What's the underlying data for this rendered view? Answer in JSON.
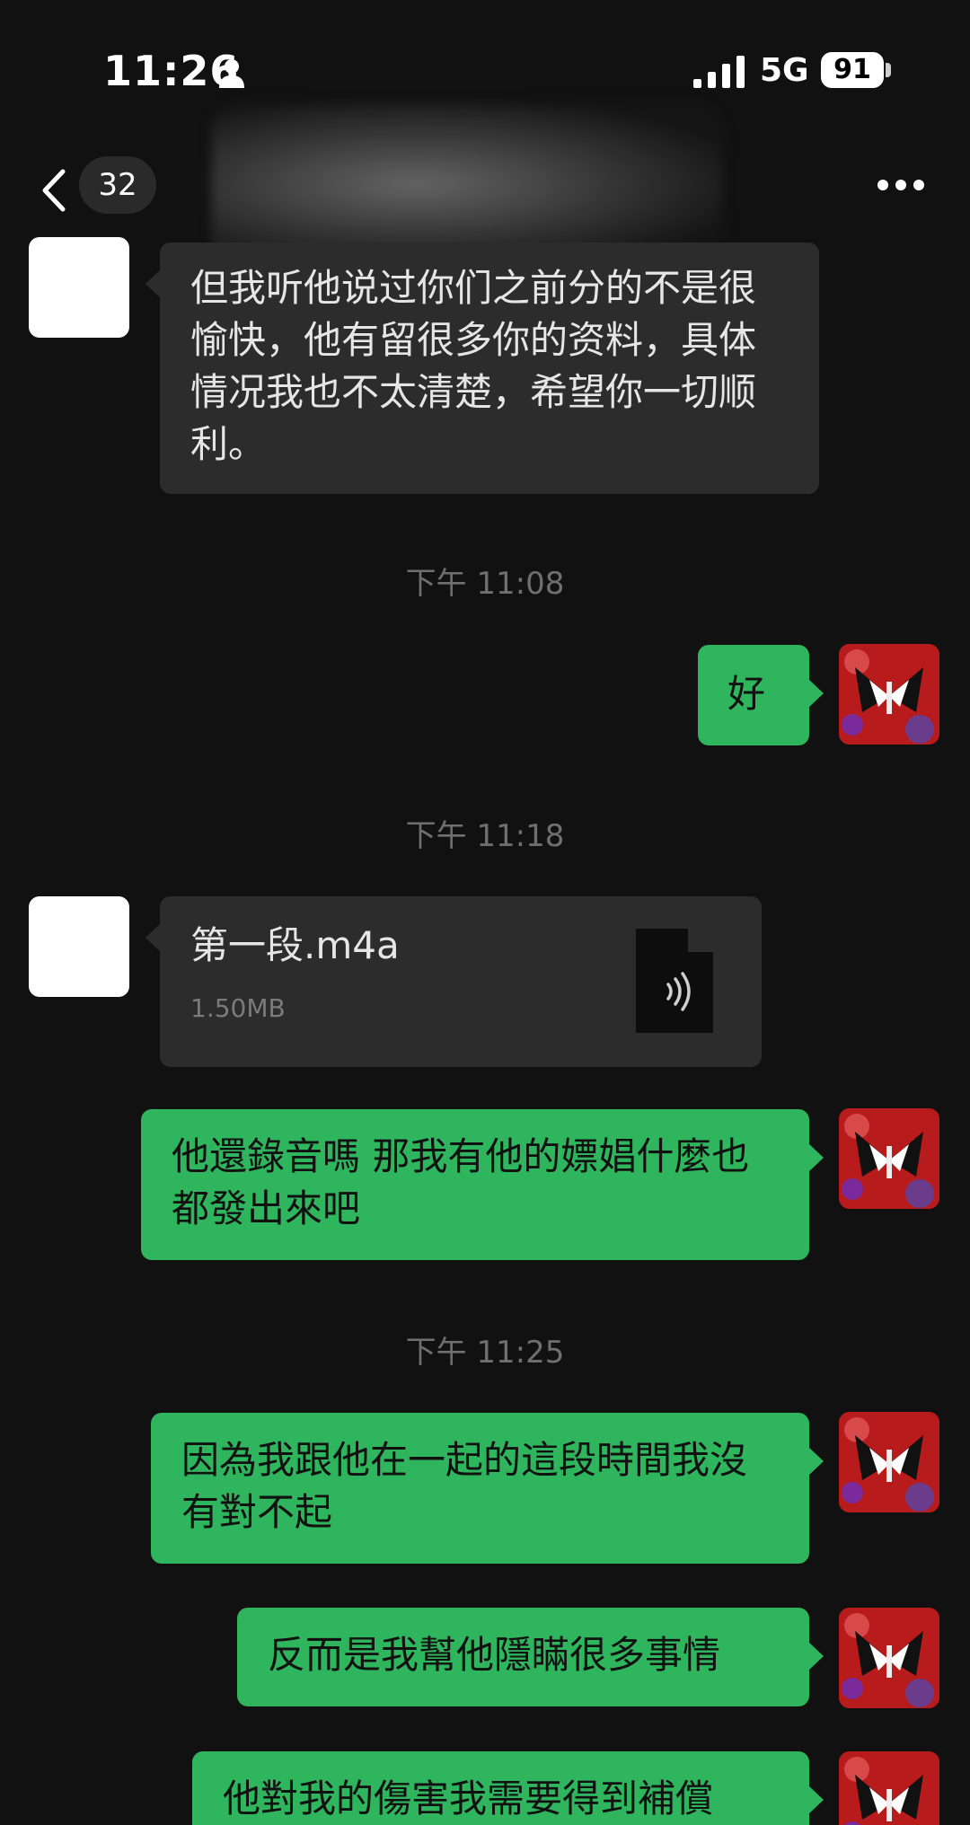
{
  "status": {
    "time": "11:26",
    "network": "5G",
    "battery": "91"
  },
  "nav": {
    "unread_count": "32"
  },
  "messages": [
    {
      "type": "text",
      "sender": "other",
      "text": "但我听他说过你们之前分的不是很愉快，他有留很多你的资料，具体情况我也不太清楚，希望你一切顺利。"
    },
    {
      "type": "time",
      "text": "下午 11:08"
    },
    {
      "type": "text",
      "sender": "self",
      "text": "好"
    },
    {
      "type": "time",
      "text": "下午 11:18"
    },
    {
      "type": "file",
      "sender": "other",
      "name": "第一段.m4a",
      "size": "1.50MB",
      "icon": "audio-file-icon"
    },
    {
      "type": "text",
      "sender": "self",
      "text": "他還錄音嗎 那我有他的嫖娼什麼也都發出來吧"
    },
    {
      "type": "time",
      "text": "下午 11:25"
    },
    {
      "type": "text",
      "sender": "self",
      "text": "因為我跟他在一起的這段時間我沒有對不起"
    },
    {
      "type": "text",
      "sender": "self",
      "text": "反而是我幫他隱瞞很多事情"
    },
    {
      "type": "text",
      "sender": "self",
      "text": "他對我的傷害我需要得到補償"
    }
  ],
  "colors": {
    "outgoing_bubble": "#2fb55d",
    "incoming_bubble": "#2c2c2c",
    "background": "#111111"
  }
}
